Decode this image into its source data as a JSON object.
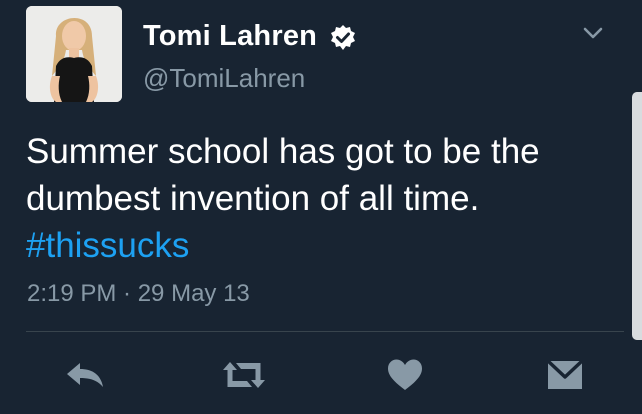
{
  "tweet": {
    "display_name": "Tomi Lahren",
    "handle": "@TomiLahren",
    "text_line1": "Summer school has got to be the",
    "text_line2": "dumbest invention of all time.",
    "hashtag": "#thissucks",
    "timestamp": "2:19 PM · 29 May 13"
  },
  "actions": {
    "reply": "reply-icon",
    "retweet": "retweet-icon",
    "like": "heart-icon",
    "message": "envelope-icon"
  },
  "colors": {
    "background": "#182432",
    "text": "#ffffff",
    "muted": "#8899a6",
    "link": "#1da1f2"
  }
}
